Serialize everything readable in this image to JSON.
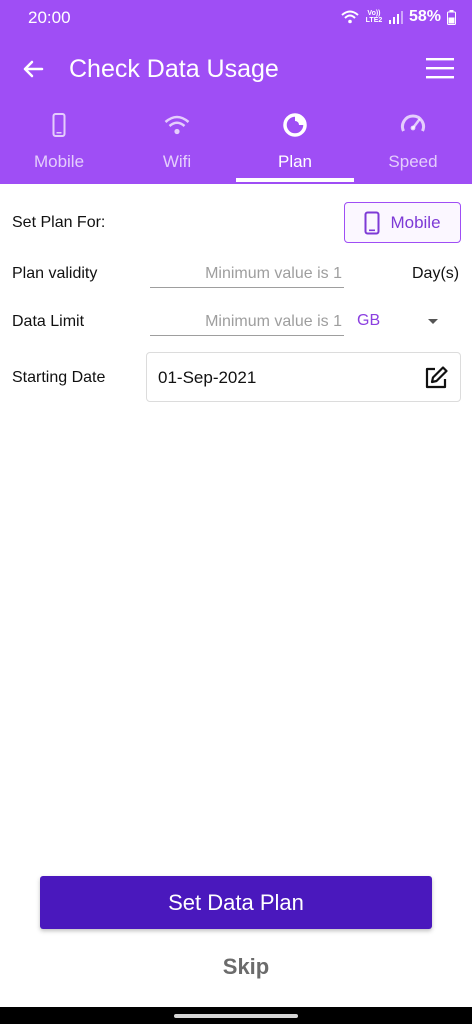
{
  "status_bar": {
    "time": "20:00",
    "network": "Vo)) LTE2",
    "battery": "58%",
    "icons": [
      "wifi-icon",
      "volte-icon",
      "signal-icon",
      "battery-icon"
    ]
  },
  "app_bar": {
    "title": "Check Data Usage",
    "back_icon": "arrow-back-icon",
    "menu_icon": "hamburger-menu-icon"
  },
  "tabs": [
    {
      "label": "Mobile",
      "icon": "phone-icon",
      "active": false
    },
    {
      "label": "Wifi",
      "icon": "wifi-icon",
      "active": false
    },
    {
      "label": "Plan",
      "icon": "plan-icon",
      "active": true
    },
    {
      "label": "Speed",
      "icon": "speedometer-icon",
      "active": false
    }
  ],
  "form": {
    "set_plan_for_label": "Set Plan For:",
    "set_plan_for_value": "Mobile",
    "plan_validity_label": "Plan validity",
    "plan_validity_placeholder": "Minimum value is 1",
    "plan_validity_unit": "Day(s)",
    "data_limit_label": "Data Limit",
    "data_limit_placeholder": "Minimum value is 1",
    "data_limit_unit": "GB",
    "starting_date_label": "Starting Date",
    "starting_date_value": "01-Sep-2021"
  },
  "actions": {
    "primary": "Set Data Plan",
    "secondary": "Skip"
  },
  "colors": {
    "header": "#9f4ef5",
    "primary_button": "#4a18bd",
    "accent_text": "#8b3fe0"
  }
}
